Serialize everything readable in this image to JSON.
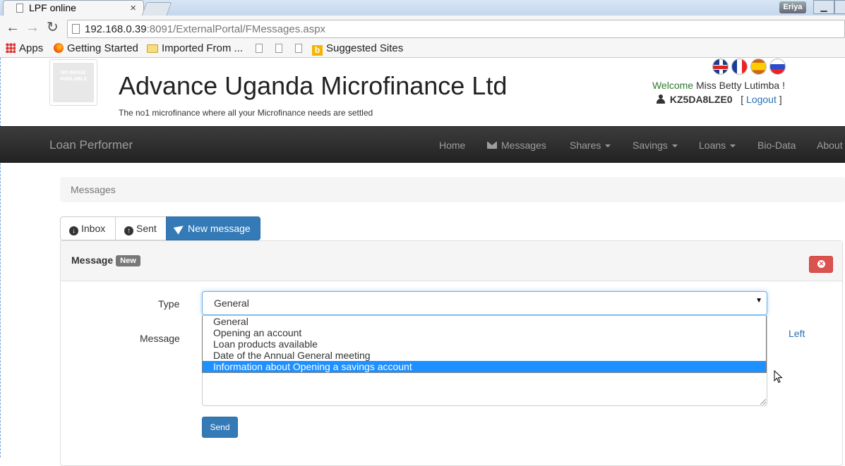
{
  "browser": {
    "tab_title": "LPF online",
    "tab_close": "×",
    "user_badge": "Eriya",
    "url_host": "192.168.0.39",
    "url_rest": ":8091/ExternalPortal/FMessages.aspx",
    "back": "←",
    "forward": "→",
    "reload": "↻"
  },
  "bookmarks": [
    {
      "label": "Apps",
      "icon": "apps-grid-icon"
    },
    {
      "label": "Getting Started",
      "icon": "firefox-icon"
    },
    {
      "label": "Imported From ...",
      "icon": "folder-icon"
    },
    {
      "label": "Suggested Sites",
      "icon": "bing-icon"
    }
  ],
  "header": {
    "logo_text": "NO IMAGE AVAILABLE",
    "org_name": "Advance Uganda Microfinance Ltd",
    "tagline": "The no1 microfinance where all your Microfinance needs are settled",
    "welcome_prefix": "Welcome ",
    "welcome_name": "Miss Betty Lutimba !",
    "user_code": "KZ5DA8LZE0",
    "logout": "Logout",
    "flags": [
      "uk-flag-icon",
      "france-flag-icon",
      "spain-flag-icon",
      "russia-flag-icon"
    ]
  },
  "navbar": {
    "brand": "Loan Performer",
    "items": {
      "home": "Home",
      "messages": "Messages",
      "shares": "Shares",
      "savings": "Savings",
      "loans": "Loans",
      "biodata": "Bio-Data",
      "about": "About"
    }
  },
  "breadcrumb": "Messages",
  "tabs": {
    "inbox": "Inbox",
    "sent": "Sent",
    "new_message": "New message"
  },
  "panel": {
    "title": "Message",
    "badge": "New"
  },
  "form": {
    "type_label": "Type",
    "message_label": "Message",
    "type_value": "General",
    "type_options": [
      "General",
      "Opening an account",
      "Loan products available",
      "Date of the Annual General meeting",
      "Information about Opening a savings account"
    ],
    "highlighted_option": "Information about Opening a savings account",
    "left_label": "Left",
    "send": "Send"
  },
  "colors": {
    "primary": "#337ab7",
    "danger": "#d9534f",
    "navbar": "#222222",
    "highlight": "#1e90ff",
    "welcome_green": "#2f7a2f"
  }
}
